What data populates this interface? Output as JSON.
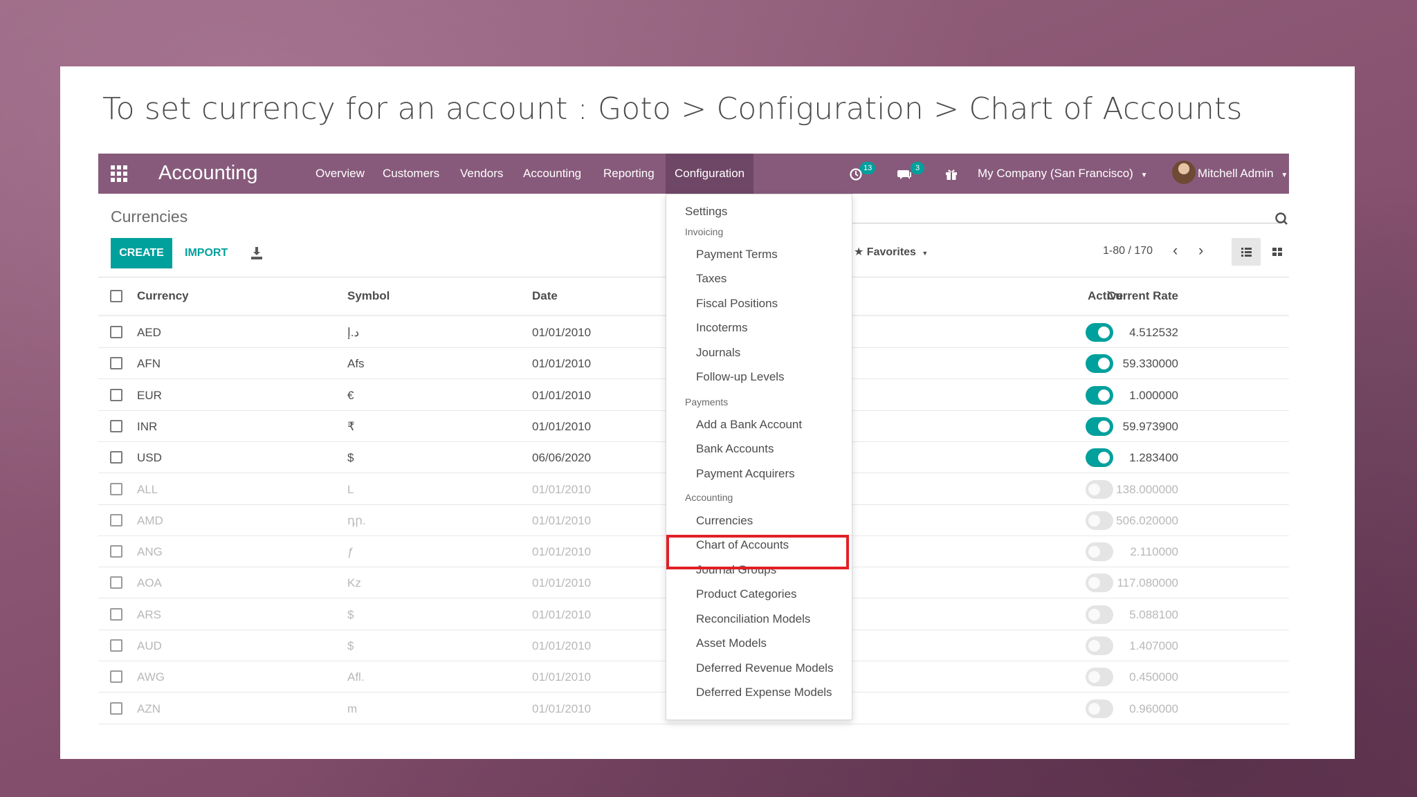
{
  "caption": "To set currency for an account :  Goto > Configuration >  Chart of Accounts",
  "navbar": {
    "apps_icon": "apps-grid-icon",
    "brand": "Accounting",
    "menu": [
      "Overview",
      "Customers",
      "Vendors",
      "Accounting",
      "Reporting",
      "Configuration"
    ],
    "activity_count": "13",
    "messages_count": "3",
    "company": "My Company (San Francisco)",
    "user": "Mitchell Admin",
    "color": "#875a7b"
  },
  "control_panel": {
    "breadcrumb": "Currencies",
    "create_label": "CREATE",
    "import_label": "IMPORT",
    "favorites_label": "Favorites",
    "pager": "1-80 / 170"
  },
  "table": {
    "headers": {
      "currency": "Currency",
      "symbol": "Symbol",
      "date": "Date",
      "rate": "Current Rate",
      "active": "Active"
    },
    "rows": [
      {
        "currency": "AED",
        "symbol": "د.إ",
        "date": "01/01/2010",
        "rate": "4.512532",
        "active": true
      },
      {
        "currency": "AFN",
        "symbol": "Afs",
        "date": "01/01/2010",
        "rate": "59.330000",
        "active": true
      },
      {
        "currency": "EUR",
        "symbol": "€",
        "date": "01/01/2010",
        "rate": "1.000000",
        "active": true
      },
      {
        "currency": "INR",
        "symbol": "₹",
        "date": "01/01/2010",
        "rate": "59.973900",
        "active": true
      },
      {
        "currency": "USD",
        "symbol": "$",
        "date": "06/06/2020",
        "rate": "1.283400",
        "active": true
      },
      {
        "currency": "ALL",
        "symbol": "L",
        "date": "01/01/2010",
        "rate": "138.000000",
        "active": false
      },
      {
        "currency": "AMD",
        "symbol": "դր.",
        "date": "01/01/2010",
        "rate": "506.020000",
        "active": false
      },
      {
        "currency": "ANG",
        "symbol": "ƒ",
        "date": "01/01/2010",
        "rate": "2.110000",
        "active": false
      },
      {
        "currency": "AOA",
        "symbol": "Kz",
        "date": "01/01/2010",
        "rate": "117.080000",
        "active": false
      },
      {
        "currency": "ARS",
        "symbol": "$",
        "date": "01/01/2010",
        "rate": "5.088100",
        "active": false
      },
      {
        "currency": "AUD",
        "symbol": "$",
        "date": "01/01/2010",
        "rate": "1.407000",
        "active": false
      },
      {
        "currency": "AWG",
        "symbol": "Afl.",
        "date": "01/01/2010",
        "rate": "0.450000",
        "active": false
      },
      {
        "currency": "AZN",
        "symbol": "m",
        "date": "01/01/2010",
        "rate": "0.960000",
        "active": false
      }
    ]
  },
  "dropdown": {
    "settings": "Settings",
    "invoicing_header": "Invoicing",
    "invoicing": [
      "Payment Terms",
      "Taxes",
      "Fiscal Positions",
      "Incoterms",
      "Journals",
      "Follow-up Levels"
    ],
    "payments_header": "Payments",
    "payments": [
      "Add a Bank Account",
      "Bank Accounts",
      "Payment Acquirers"
    ],
    "accounting_header": "Accounting",
    "accounting": [
      "Currencies",
      "Chart of Accounts",
      "Journal Groups",
      "Product Categories",
      "Reconciliation Models",
      "Asset Models",
      "Deferred Revenue Models",
      "Deferred Expense Models"
    ],
    "highlighted": "Chart of Accounts",
    "highlight_color": "#e11f26"
  }
}
